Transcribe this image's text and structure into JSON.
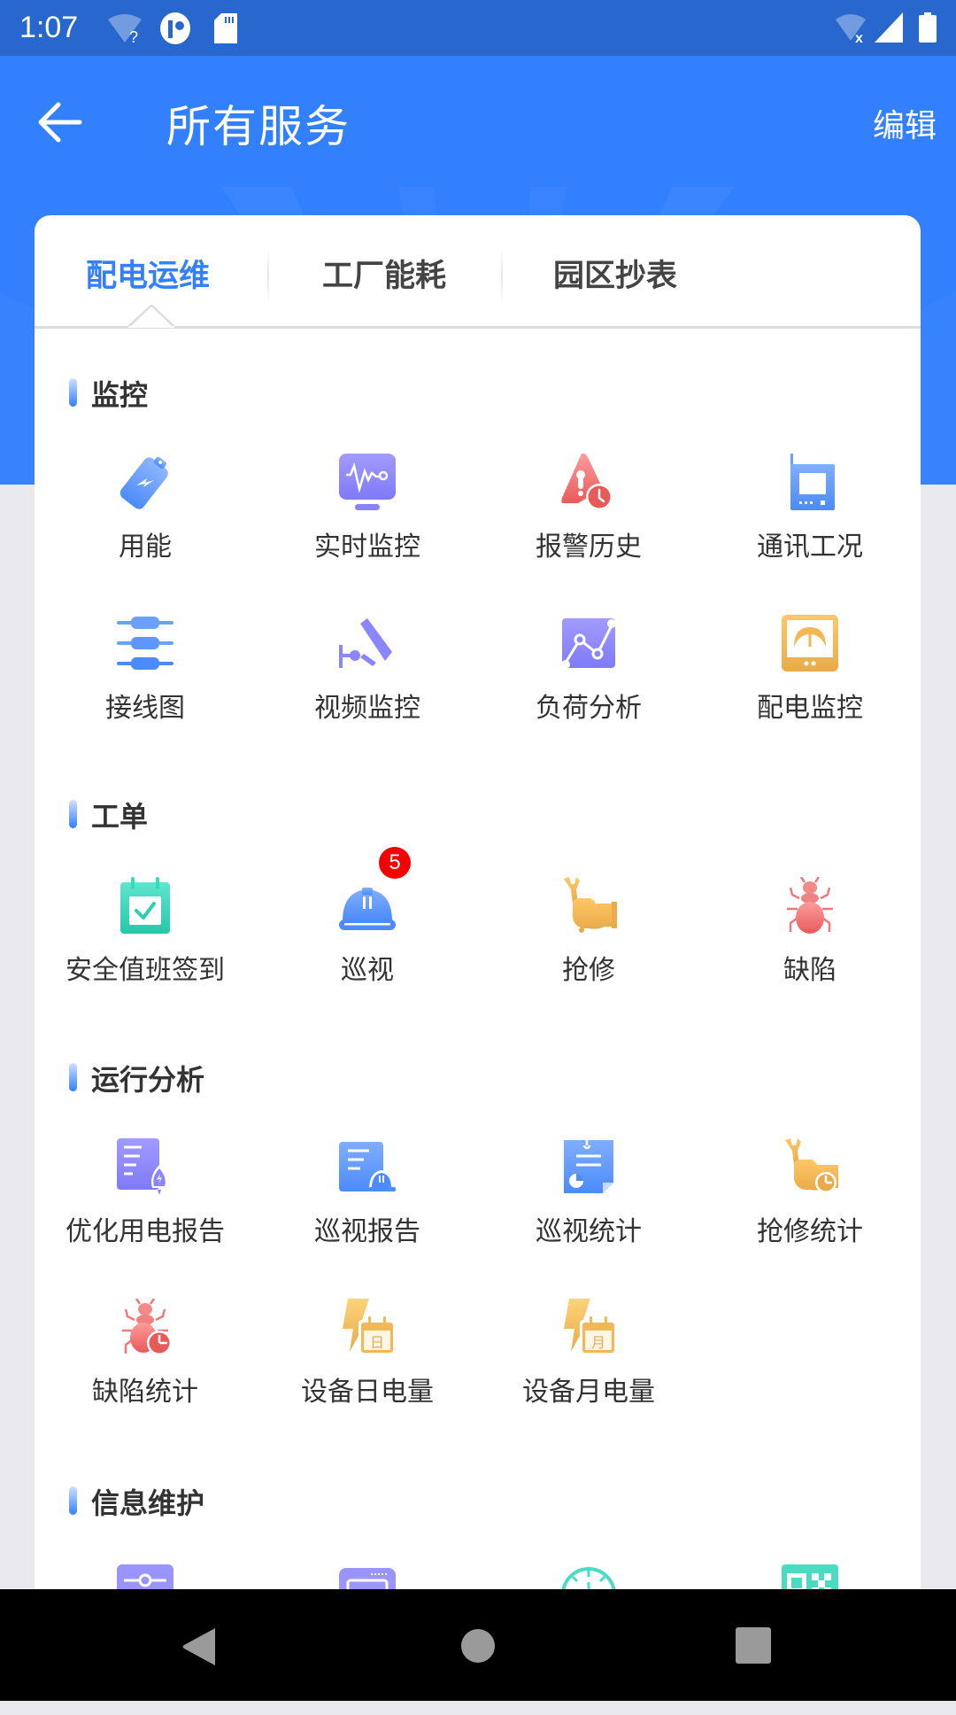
{
  "status_bar": {
    "time": "1:07",
    "left_icons": [
      "wifi-unknown-icon",
      "app-notification-icon",
      "sd-card-icon"
    ],
    "right_icons": [
      "wifi-off-icon",
      "cell-signal-icon",
      "battery-icon"
    ]
  },
  "header": {
    "title": "所有服务",
    "edit_label": "编辑",
    "back_icon": "arrow-left-icon"
  },
  "tabs": [
    {
      "label": "配电运维",
      "active": true
    },
    {
      "label": "工厂能耗",
      "active": false
    },
    {
      "label": "园区抄表",
      "active": false
    }
  ],
  "sections": [
    {
      "title": "监控",
      "items": [
        {
          "label": "用能",
          "icon": "battery-bolt-icon"
        },
        {
          "label": "实时监控",
          "icon": "monitor-pulse-icon"
        },
        {
          "label": "报警历史",
          "icon": "alarm-history-icon"
        },
        {
          "label": "通讯工况",
          "icon": "walkie-talkie-icon"
        },
        {
          "label": "接线图",
          "icon": "wiring-diagram-icon"
        },
        {
          "label": "视频监控",
          "icon": "cctv-camera-icon"
        },
        {
          "label": "负荷分析",
          "icon": "line-chart-icon"
        },
        {
          "label": "配电监控",
          "icon": "gauge-meter-icon"
        }
      ]
    },
    {
      "title": "工单",
      "items": [
        {
          "label": "安全值班签到",
          "icon": "calendar-check-icon"
        },
        {
          "label": "巡视",
          "icon": "hard-hat-icon",
          "badge": "5"
        },
        {
          "label": "抢修",
          "icon": "wrench-hand-icon"
        },
        {
          "label": "缺陷",
          "icon": "bug-icon"
        }
      ]
    },
    {
      "title": "运行分析",
      "items": [
        {
          "label": "优化用电报告",
          "icon": "report-rocket-icon"
        },
        {
          "label": "巡视报告",
          "icon": "report-helmet-icon"
        },
        {
          "label": "巡视统计",
          "icon": "clipboard-pie-icon"
        },
        {
          "label": "抢修统计",
          "icon": "wrench-stats-icon"
        },
        {
          "label": "缺陷统计",
          "icon": "bug-stats-icon"
        },
        {
          "label": "设备日电量",
          "icon": "bolt-day-calendar-icon",
          "calendar_char": "日"
        },
        {
          "label": "设备月电量",
          "icon": "bolt-month-calendar-icon",
          "calendar_char": "月"
        }
      ]
    },
    {
      "title": "信息维护",
      "items": [
        {
          "label": "",
          "icon": "sliders-icon"
        },
        {
          "label": "",
          "icon": "screen-icon"
        },
        {
          "label": "",
          "icon": "meter-dial-icon"
        },
        {
          "label": "",
          "icon": "qr-code-icon"
        }
      ]
    }
  ],
  "colors": {
    "primary": "#3380FE",
    "status_bar": "#2767CE",
    "badge": "#F50000",
    "text": "#333333"
  },
  "nav_bar": [
    "back-triangle-icon",
    "home-circle-icon",
    "recents-square-icon"
  ]
}
